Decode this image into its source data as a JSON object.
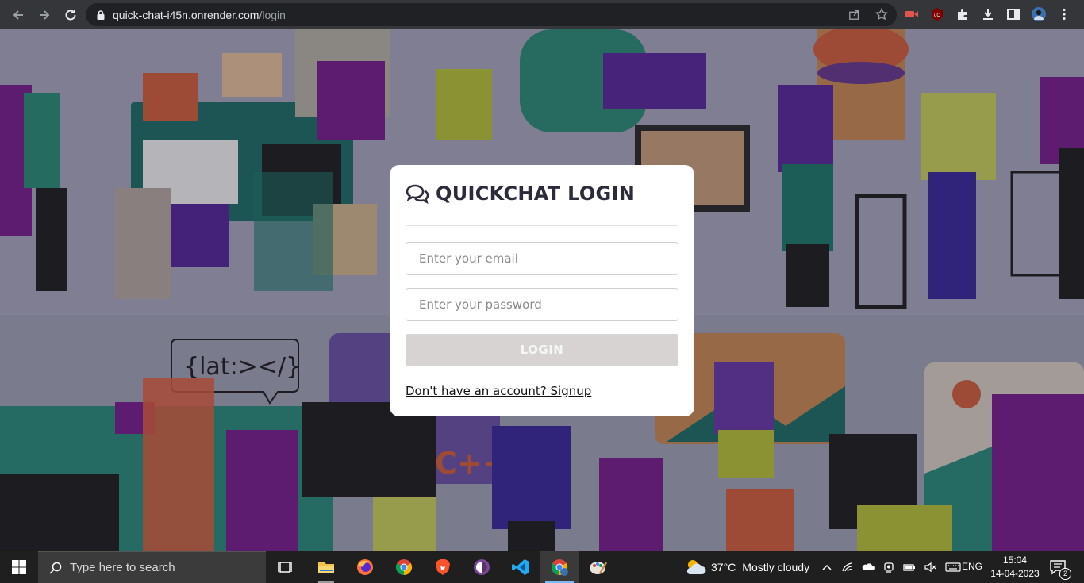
{
  "browser": {
    "url_host": "quick-chat-i45n.onrender.com",
    "url_path": "/login",
    "nav": [
      "back-icon",
      "forward-icon",
      "reload-icon"
    ],
    "omnibox_icons": [
      "share-icon",
      "bookmark-star-icon"
    ],
    "extension_icons": [
      "screen-recorder-extension-icon",
      "ublock-extension-icon",
      "extensions-puzzle-icon",
      "download-icon",
      "side-panel-icon",
      "profile-avatar",
      "menu-kebab-icon"
    ]
  },
  "login": {
    "title": "QUICKCHAT LOGIN",
    "title_icon": "chat-bubbles-icon",
    "email_placeholder": "Enter your email",
    "password_placeholder": "Enter your password",
    "button_label": "LOGIN",
    "signup_text": "Don't have an account? Signup"
  },
  "background": {
    "code_bubble_text": "{lat:></}",
    "cpp_text": "C++"
  },
  "taskbar": {
    "search_placeholder": "Type here to search",
    "apps": [
      "task-view-icon",
      "file-explorer-icon",
      "firefox-icon",
      "chrome-icon",
      "brave-icon",
      "tor-browser-icon",
      "vscode-icon",
      "chrome-profile-icon",
      "paint-icon"
    ],
    "weather_temp": "37°C",
    "weather_condition": "Mostly cloudy",
    "language": "ENG",
    "time": "15:04",
    "date": "14-04-2023",
    "notification_count": "2"
  },
  "colors": {
    "chrome_bar": "#35363a",
    "omnibox": "#202124",
    "card_bg": "#ffffff",
    "login_button_bg": "#d8d3d3",
    "taskbar": "#1f1f1f"
  }
}
